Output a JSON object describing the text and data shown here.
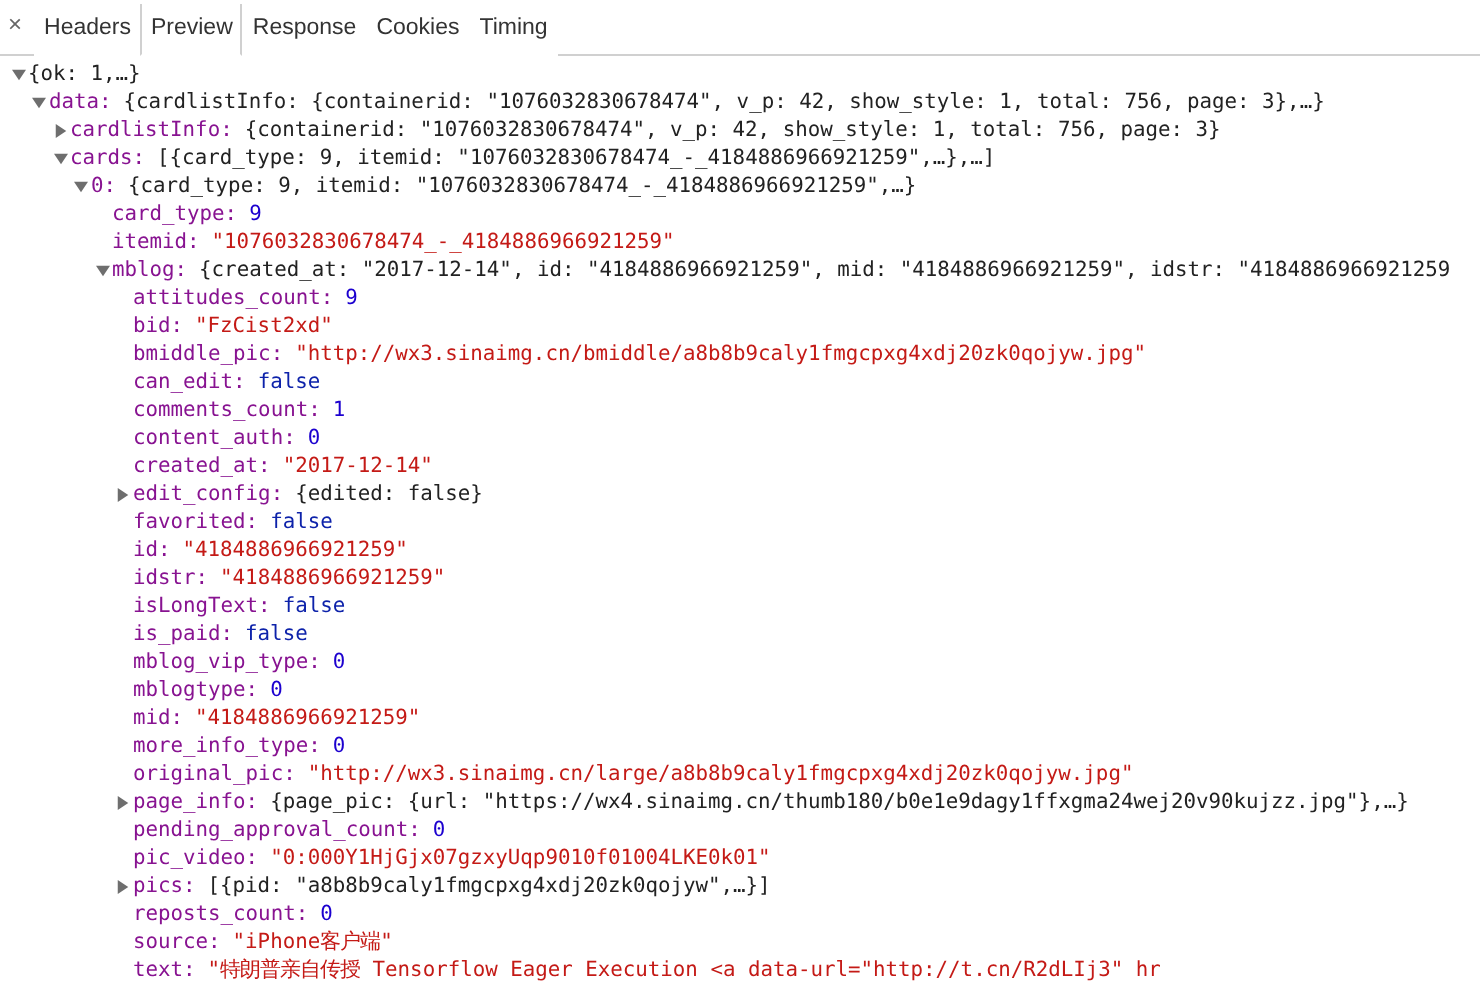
{
  "close": "×",
  "tabs": [
    {
      "label": "Headers",
      "selected": false
    },
    {
      "label": "Preview",
      "selected": true
    },
    {
      "label": "Response",
      "selected": false
    },
    {
      "label": "Cookies",
      "selected": false
    },
    {
      "label": "Timing",
      "selected": false
    }
  ],
  "tree": [
    {
      "value": "{ok: 1,…}",
      "kind": "summary",
      "expanded": true,
      "children": [
        {
          "key": "data:",
          "value": "{cardlistInfo: {containerid: \"1076032830678474\", v_p: 42, show_style: 1, total: 756, page: 3},…}",
          "kind": "summary",
          "expanded": true,
          "children": [
            {
              "key": "cardlistInfo:",
              "value": "{containerid: \"1076032830678474\", v_p: 42, show_style: 1, total: 756, page: 3}",
              "kind": "summary",
              "expanded": false
            },
            {
              "key": "cards:",
              "value": "[{card_type: 9, itemid: \"1076032830678474_-_4184886966921259\",…},…]",
              "kind": "summary",
              "expanded": true,
              "children": [
                {
                  "key": "0:",
                  "value": "{card_type: 9, itemid: \"1076032830678474_-_4184886966921259\",…}",
                  "kind": "summary",
                  "expanded": true,
                  "children": [
                    {
                      "key": "card_type:",
                      "value": "9",
                      "kind": "number"
                    },
                    {
                      "key": "itemid:",
                      "value": "\"1076032830678474_-_4184886966921259\"",
                      "kind": "string"
                    },
                    {
                      "key": "mblog:",
                      "value": "{created_at: \"2017-12-14\", id: \"4184886966921259\", mid: \"4184886966921259\", idstr: \"4184886966921259",
                      "kind": "summary",
                      "expanded": true,
                      "children": [
                        {
                          "key": "attitudes_count:",
                          "value": "9",
                          "kind": "number"
                        },
                        {
                          "key": "bid:",
                          "value": "\"FzCist2xd\"",
                          "kind": "string"
                        },
                        {
                          "key": "bmiddle_pic:",
                          "value": "\"http://wx3.sinaimg.cn/bmiddle/a8b8b9caly1fmgcpxg4xdj20zk0qojyw.jpg\"",
                          "kind": "string"
                        },
                        {
                          "key": "can_edit:",
                          "value": "false",
                          "kind": "boolean"
                        },
                        {
                          "key": "comments_count:",
                          "value": "1",
                          "kind": "number"
                        },
                        {
                          "key": "content_auth:",
                          "value": "0",
                          "kind": "number"
                        },
                        {
                          "key": "created_at:",
                          "value": "\"2017-12-14\"",
                          "kind": "string"
                        },
                        {
                          "key": "edit_config:",
                          "value": "{edited: false}",
                          "kind": "summary",
                          "expanded": false
                        },
                        {
                          "key": "favorited:",
                          "value": "false",
                          "kind": "boolean"
                        },
                        {
                          "key": "id:",
                          "value": "\"4184886966921259\"",
                          "kind": "string"
                        },
                        {
                          "key": "idstr:",
                          "value": "\"4184886966921259\"",
                          "kind": "string"
                        },
                        {
                          "key": "isLongText:",
                          "value": "false",
                          "kind": "boolean"
                        },
                        {
                          "key": "is_paid:",
                          "value": "false",
                          "kind": "boolean"
                        },
                        {
                          "key": "mblog_vip_type:",
                          "value": "0",
                          "kind": "number"
                        },
                        {
                          "key": "mblogtype:",
                          "value": "0",
                          "kind": "number"
                        },
                        {
                          "key": "mid:",
                          "value": "\"4184886966921259\"",
                          "kind": "string"
                        },
                        {
                          "key": "more_info_type:",
                          "value": "0",
                          "kind": "number"
                        },
                        {
                          "key": "original_pic:",
                          "value": "\"http://wx3.sinaimg.cn/large/a8b8b9caly1fmgcpxg4xdj20zk0qojyw.jpg\"",
                          "kind": "string"
                        },
                        {
                          "key": "page_info:",
                          "value": "{page_pic: {url: \"https://wx4.sinaimg.cn/thumb180/b0e1e9dagy1ffxgma24wej20v90kujzz.jpg\"},…}",
                          "kind": "summary",
                          "expanded": false
                        },
                        {
                          "key": "pending_approval_count:",
                          "value": "0",
                          "kind": "number"
                        },
                        {
                          "key": "pic_video:",
                          "value": "\"0:000Y1HjGjx07gzxyUqp9010f01004LKE0k01\"",
                          "kind": "string"
                        },
                        {
                          "key": "pics:",
                          "value": "[{pid: \"a8b8b9caly1fmgcpxg4xdj20zk0qojyw\",…}]",
                          "kind": "summary",
                          "expanded": false
                        },
                        {
                          "key": "reposts_count:",
                          "value": "0",
                          "kind": "number"
                        },
                        {
                          "key": "source:",
                          "value": "\"iPhone客户端\"",
                          "kind": "string"
                        },
                        {
                          "key": "text:",
                          "value": "\"特朗普亲自传授 Tensorflow Eager Execution <a data-url=\"http://t.cn/R2dLIj3\" hr",
                          "kind": "string"
                        }
                      ]
                    }
                  ]
                }
              ]
            }
          ]
        }
      ]
    }
  ]
}
